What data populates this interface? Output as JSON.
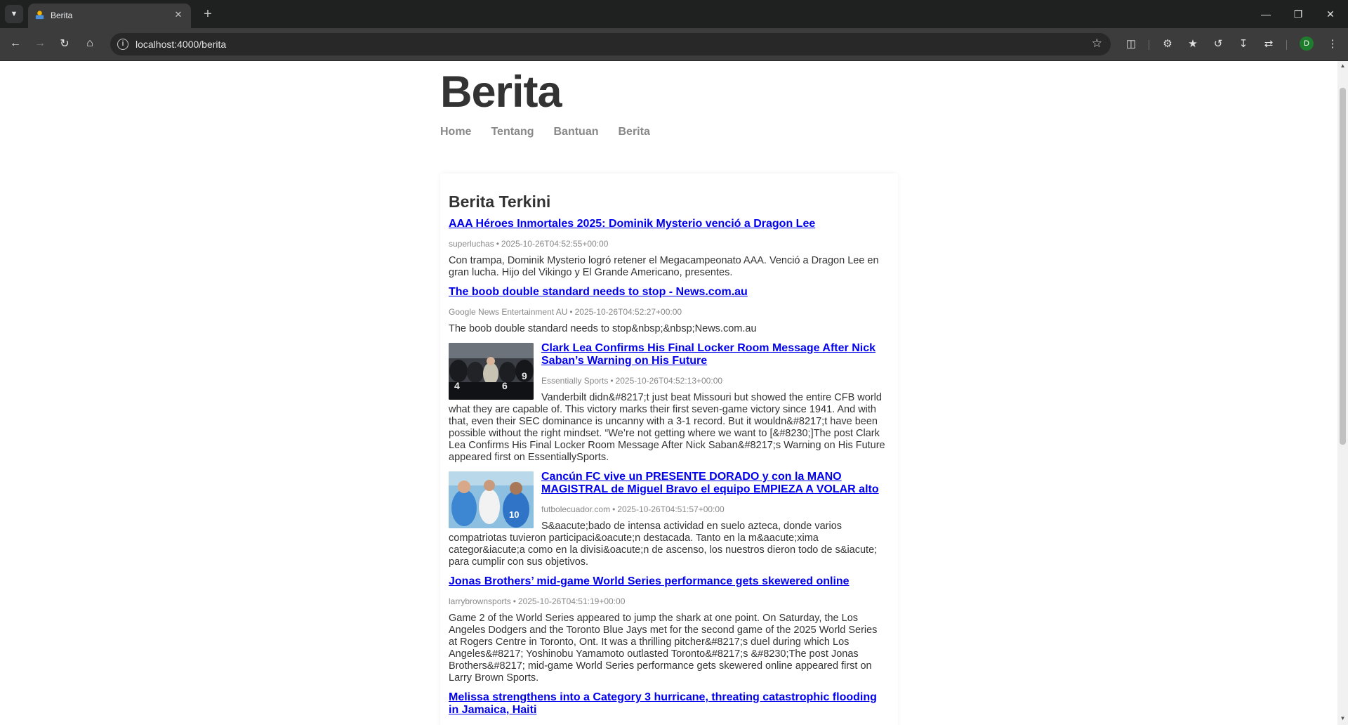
{
  "browser": {
    "tab": {
      "title": "Berita"
    },
    "address": {
      "url": "localhost:4000/berita"
    },
    "profile_initial": "D"
  },
  "site": {
    "title": "Berita",
    "nav": [
      "Home",
      "Tentang",
      "Bantuan",
      "Berita"
    ]
  },
  "section": {
    "heading": "Berita Terkini"
  },
  "articles": [
    {
      "title": "AAA Héroes Inmortales 2025: Dominik Mysterio venció a Dragon Lee",
      "source": "superluchas",
      "timestamp": "2025-10-26T04:52:55+00:00",
      "summary": "Con trampa, Dominik Mysterio logró retener el Megacampeonato AAA. Venció a Dragon Lee en gran lucha. Hijo del Vikingo y El Grande Americano, presentes."
    },
    {
      "title": "The boob double standard needs to stop - News.com.au",
      "source": "Google News Entertainment AU",
      "timestamp": "2025-10-26T04:52:27+00:00",
      "summary": "The boob double standard needs to stop&nbsp;&nbsp;News.com.au"
    },
    {
      "title": "Clark Lea Confirms His Final Locker Room Message After Nick Saban’s Warning on His Future",
      "source": "Essentially Sports",
      "timestamp": "2025-10-26T04:52:13+00:00",
      "summary": "Vanderbilt didn&#8217;t just beat Missouri but showed the entire CFB world what they are capable of. This victory marks their first seven-game victory since 1941. And with that, even their SEC dominance is uncanny with a 3-1 record. But it wouldn&#8217;t have been possible without the right mindset. “We’re not getting where we want to [&#8230;]The post Clark Lea Confirms His Final Locker Room Message After Nick Saban&#8217;s Warning on His Future appeared first on EssentiallySports.",
      "thumbnail": "football-team-photo"
    },
    {
      "title": "Cancún FC vive un PRESENTE DORADO y con la MANO MAGISTRAL de Miguel Bravo el equipo EMPIEZA A VOLAR alto",
      "source": "futbolecuador.com",
      "timestamp": "2025-10-26T04:51:57+00:00",
      "summary": "S&aacute;bado de intensa actividad en suelo azteca, donde varios compatriotas tuvieron participaci&oacute;n destacada. Tanto en la m&aacute;xima categor&iacute;a como en la divisi&oacute;n de ascenso, los nuestros dieron todo de s&iacute; para cumplir con sus objetivos.",
      "thumbnail": "soccer-team-photo"
    },
    {
      "title": "Jonas Brothers’ mid-game World Series performance gets skewered online",
      "source": "larrybrownsports",
      "timestamp": "2025-10-26T04:51:19+00:00",
      "summary": "Game 2 of the World Series appeared to jump the shark at one point. On Saturday, the Los Angeles Dodgers and the Toronto Blue Jays met for the second game of the 2025 World Series at Rogers Centre in Toronto, Ont. It was a thrilling pitcher&#8217;s duel during which Los Angeles&#8217; Yoshinobu Yamamoto outlasted Toronto&#8217;s &#8230;The post Jonas Brothers&#8217; mid-game World Series performance gets skewered online appeared first on Larry Brown Sports."
    },
    {
      "title": "Melissa strengthens into a Category 3 hurricane, threating catastrophic flooding in Jamaica, Haiti",
      "source": "",
      "timestamp": "",
      "summary": ""
    }
  ]
}
